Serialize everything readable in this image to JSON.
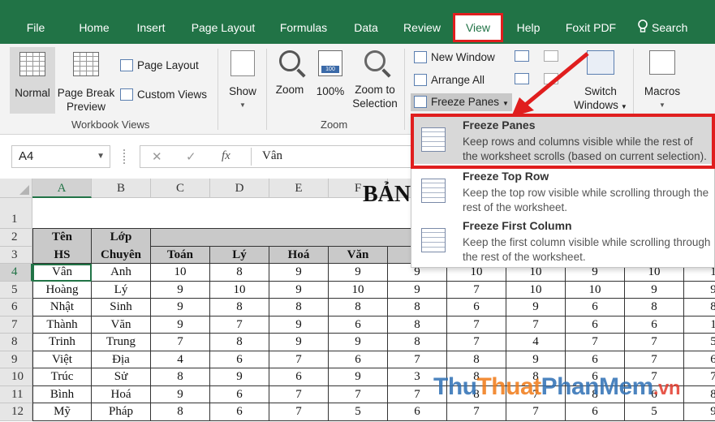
{
  "ribbon_tabs": [
    "File",
    "Home",
    "Insert",
    "Page Layout",
    "Formulas",
    "Data",
    "Review",
    "View",
    "Help",
    "Foxit PDF"
  ],
  "search_label": "Search",
  "ribbon": {
    "workbook_views": {
      "normal": "Normal",
      "page_break_1": "Page Break",
      "page_break_2": "Preview",
      "page_layout": "Page Layout",
      "custom_views": "Custom Views",
      "group_label": "Workbook Views"
    },
    "show": "Show",
    "zoom": {
      "zoom": "Zoom",
      "hundred": "100%",
      "zoom_sel_1": "Zoom to",
      "zoom_sel_2": "Selection",
      "group_label": "Zoom"
    },
    "window": {
      "new_window": "New Window",
      "arrange_all": "Arrange All",
      "freeze_panes": "Freeze Panes",
      "switch_1": "Switch",
      "switch_2": "Windows"
    },
    "macros": "Macros"
  },
  "formula_bar": {
    "name_box": "A4",
    "value": "Vân",
    "cancel": "✕",
    "enter": "✓",
    "fx": "fx"
  },
  "sheet": {
    "columns": [
      "A",
      "B",
      "C",
      "D",
      "E",
      "F"
    ],
    "title": "BẢN",
    "header_row2": [
      "Tên",
      "Lớp"
    ],
    "header_row3": [
      "HS",
      "Chuyên",
      "Toán",
      "Lý",
      "Hoá",
      "Văn"
    ],
    "rows": [
      {
        "num": "4",
        "cells": [
          "Vân",
          "Anh",
          "10",
          "8",
          "9",
          "9",
          "9",
          "10",
          "10",
          "9",
          "10",
          "1"
        ]
      },
      {
        "num": "5",
        "cells": [
          "Hoàng",
          "Lý",
          "9",
          "10",
          "9",
          "10",
          "9",
          "7",
          "10",
          "10",
          "9",
          "9"
        ]
      },
      {
        "num": "6",
        "cells": [
          "Nhật",
          "Sinh",
          "9",
          "8",
          "8",
          "8",
          "8",
          "6",
          "9",
          "6",
          "8",
          "8"
        ]
      },
      {
        "num": "7",
        "cells": [
          "Thành",
          "Văn",
          "9",
          "7",
          "9",
          "6",
          "8",
          "7",
          "7",
          "6",
          "6",
          "1"
        ]
      },
      {
        "num": "8",
        "cells": [
          "Trinh",
          "Trung",
          "7",
          "8",
          "9",
          "9",
          "8",
          "7",
          "4",
          "7",
          "7",
          "5"
        ]
      },
      {
        "num": "9",
        "cells": [
          "Việt",
          "Địa",
          "4",
          "6",
          "7",
          "6",
          "7",
          "8",
          "9",
          "6",
          "7",
          "6"
        ]
      },
      {
        "num": "10",
        "cells": [
          "Trúc",
          "Sử",
          "8",
          "9",
          "6",
          "9",
          "3",
          "8",
          "8",
          "6",
          "7",
          "7"
        ]
      },
      {
        "num": "11",
        "cells": [
          "Bình",
          "Hoá",
          "9",
          "6",
          "7",
          "7",
          "7",
          "8",
          "7",
          "8",
          "6",
          "8"
        ]
      },
      {
        "num": "12",
        "cells": [
          "Mỹ",
          "Pháp",
          "8",
          "6",
          "7",
          "5",
          "6",
          "7",
          "7",
          "6",
          "5",
          "9"
        ]
      }
    ],
    "row_numbers_top": [
      "1",
      "2",
      "3"
    ]
  },
  "freeze_menu": [
    {
      "title": "Freeze Panes",
      "desc": "Keep rows and columns visible while the rest of the worksheet scrolls (based on current selection)."
    },
    {
      "title": "Freeze Top Row",
      "desc": "Keep the top row visible while scrolling through the rest of the worksheet."
    },
    {
      "title": "Freeze First Column",
      "desc": "Keep the first column visible while scrolling through the rest of the worksheet."
    }
  ],
  "watermark": {
    "a": "Thu",
    "b": "Thuat",
    "c": "PhanMem",
    "d": ".vn"
  },
  "colors": {
    "excel_green": "#217346",
    "highlight_red": "#e01e1e",
    "header_gray": "#c9c9c9"
  }
}
